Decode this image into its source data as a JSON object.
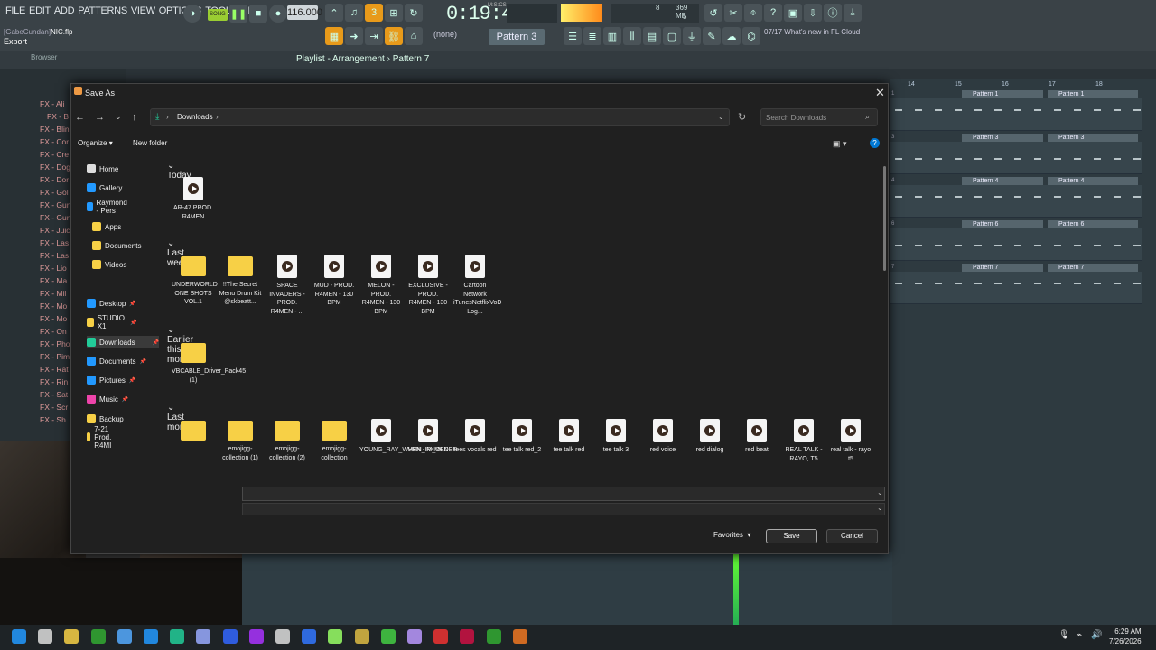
{
  "fl": {
    "menu": [
      "FILE",
      "EDIT",
      "ADD",
      "PATTERNS",
      "VIEW",
      "OPTIONS",
      "TOOLS",
      "HELP"
    ],
    "song_badge": "SONG",
    "tempo": "116.000",
    "time": "0:19:45",
    "time_unit": "M:S:CS",
    "memory": "369 MB",
    "cpu_num": "8",
    "voices": "5",
    "project_user": "[GabeCundan]",
    "project_file": "NIC.flp",
    "export_label": "Export",
    "snap": "(none)",
    "pattern": "Pattern 3",
    "news_date": "07/17",
    "news_text": "What's new in FL Cloud",
    "browser_label": "Browser",
    "playlist_title": "Playlist - Arrangement",
    "playlist_pattern": "Pattern 7"
  },
  "browser_items": [
    "FX - Ali",
    "FX - B",
    "FX - Blin",
    "FX - Cor",
    "FX - Cre",
    "FX - Dog",
    "FX - Dor",
    "FX - Gol",
    "FX - Gun",
    "FX - Gun",
    "FX - Juic",
    "FX - Las",
    "FX - Las",
    "FX - Lio",
    "FX - Ma",
    "FX - Mil",
    "FX - Mo",
    "FX - Mo",
    "FX - On",
    "FX - Pho",
    "FX - Pim",
    "FX - Rat",
    "FX - Rin",
    "FX - Sat",
    "FX - Scr",
    "FX - Sh"
  ],
  "playlist": {
    "bars": [
      "14",
      "15",
      "16",
      "17",
      "18"
    ],
    "tracks": [
      {
        "num": "1",
        "left": "Pattern 1",
        "right": "Pattern 1"
      },
      {
        "num": "3",
        "left": "Pattern 3",
        "right": "Pattern 3"
      },
      {
        "num": "4",
        "left": "Pattern 4",
        "right": "Pattern 4"
      },
      {
        "num": "6",
        "left": "Pattern 6",
        "right": "Pattern 6"
      },
      {
        "num": "7",
        "left": "Pattern 7",
        "right": "Pattern 7"
      }
    ]
  },
  "dialog": {
    "title": "Save As",
    "location": "Downloads",
    "search_placeholder": "Search Downloads",
    "organize": "Organize",
    "new_folder": "New folder",
    "nav": [
      "Home",
      "Gallery",
      "Raymond - Pers",
      "Apps",
      "Documents",
      "Videos",
      "Desktop",
      "STUDIO X1",
      "Downloads",
      "Documents",
      "Pictures",
      "Music",
      "Backup",
      "7-21 Prod. R4MI"
    ],
    "groups": {
      "today": "Today",
      "last_week": "Last week",
      "earlier": "Earlier this month",
      "last_month": "Last month"
    },
    "today_files": [
      {
        "name": "AR-47 PROD. R4MEN",
        "kind": "audio"
      }
    ],
    "last_week_files": [
      {
        "name": "UNDERWORLD ONE SHOTS VOL.1",
        "kind": "folder"
      },
      {
        "name": "!!The Secret Menu Drum Kit @skbeatt...",
        "kind": "folder"
      },
      {
        "name": "SPACE INVADERS - PROD. R4MEN - ...",
        "kind": "audio"
      },
      {
        "name": "MUD - PROD. R4MEN - 130 BPM",
        "kind": "audio"
      },
      {
        "name": "MELON - PROD. R4MEN - 130 BPM",
        "kind": "audio"
      },
      {
        "name": "EXCLUSIVE - PROD. R4MEN - 130 BPM",
        "kind": "audio"
      },
      {
        "name": "Cartoon Network iTunesNetflixVoD Log...",
        "kind": "audio"
      }
    ],
    "earlier_files": [
      {
        "name": "VBCABLE_Driver_Pack45 (1)",
        "kind": "folder"
      }
    ],
    "last_month_files": [
      {
        "name": "",
        "kind": "folder"
      },
      {
        "name": "emojigg-collection (1)",
        "kind": "folder"
      },
      {
        "name": "emojigg-collection (2)",
        "kind": "folder"
      },
      {
        "name": "emojigg-collection",
        "kind": "folder"
      },
      {
        "name": "YOUNG_RAY_WHEN_IM_OLDER",
        "kind": "audio"
      },
      {
        "name": "VPN - R4MEN",
        "kind": "audio"
      },
      {
        "name": "tees vocals red",
        "kind": "audio"
      },
      {
        "name": "tee talk red_2",
        "kind": "audio"
      },
      {
        "name": "tee talk red",
        "kind": "audio"
      },
      {
        "name": "tee talk 3",
        "kind": "audio"
      },
      {
        "name": "red voice",
        "kind": "audio"
      },
      {
        "name": "red dialog",
        "kind": "audio"
      },
      {
        "name": "red beat",
        "kind": "audio"
      },
      {
        "name": "REAL TALK - RAYO, T5",
        "kind": "audio"
      },
      {
        "name": "real talk - rayo t5",
        "kind": "audio"
      }
    ],
    "favorites": "Favorites",
    "save": "Save",
    "cancel": "Cancel"
  },
  "taskbar": {
    "time": "6:29 AM",
    "date": "7/26/2026"
  },
  "colors": {
    "accent": "#0078d4",
    "fl_green": "#9acd32",
    "folder": "#f7d046"
  }
}
